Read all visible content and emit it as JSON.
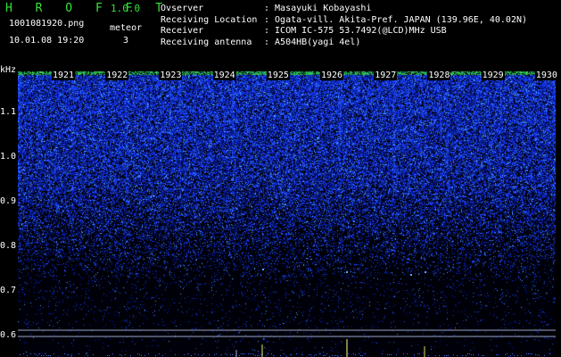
{
  "header": {
    "brand": "H R O F F T",
    "version": "1.0.0",
    "filename": "1001081920.png",
    "datetime": "10.01.08 19:20",
    "meteor_label": "meteor",
    "meteor_count": "3"
  },
  "info": [
    {
      "label": "Ovserver",
      "value": ": Masayuki Kobayashi"
    },
    {
      "label": "Receiving Location",
      "value": ": Ogata-vill. Akita-Pref. JAPAN (139.96E, 40.02N)"
    },
    {
      "label": "Receiver",
      "value": ": ICOM IC-575 53.7492(@LCD)MHz USB"
    },
    {
      "label": "Receiving antenna",
      "value": ": A504HB(yagi 4el)"
    }
  ],
  "y_axis": {
    "unit": "kHz",
    "ticks": [
      "1.1",
      "1.0",
      "0.9",
      "0.8",
      "0.7",
      "0.6"
    ]
  },
  "time_axis": {
    "ticks": [
      "1921",
      "1922",
      "1923",
      "1924",
      "1925",
      "1926",
      "1927",
      "1928",
      "1929",
      "1930"
    ]
  },
  "colors": {
    "brand": "#36e23a",
    "background": "#000000",
    "signal": "#1e3cff",
    "signal_hot": "#4aa8ff",
    "top_band": "#3ad84a",
    "reference_line": "#9aa6c6"
  },
  "chart_data": {
    "type": "heatmap",
    "x": [
      "1921",
      "1922",
      "1923",
      "1924",
      "1925",
      "1926",
      "1927",
      "1928",
      "1929",
      "1930"
    ],
    "ylabel": "kHz",
    "ylim": [
      0.6,
      1.15
    ],
    "meteor_count": 3
  }
}
